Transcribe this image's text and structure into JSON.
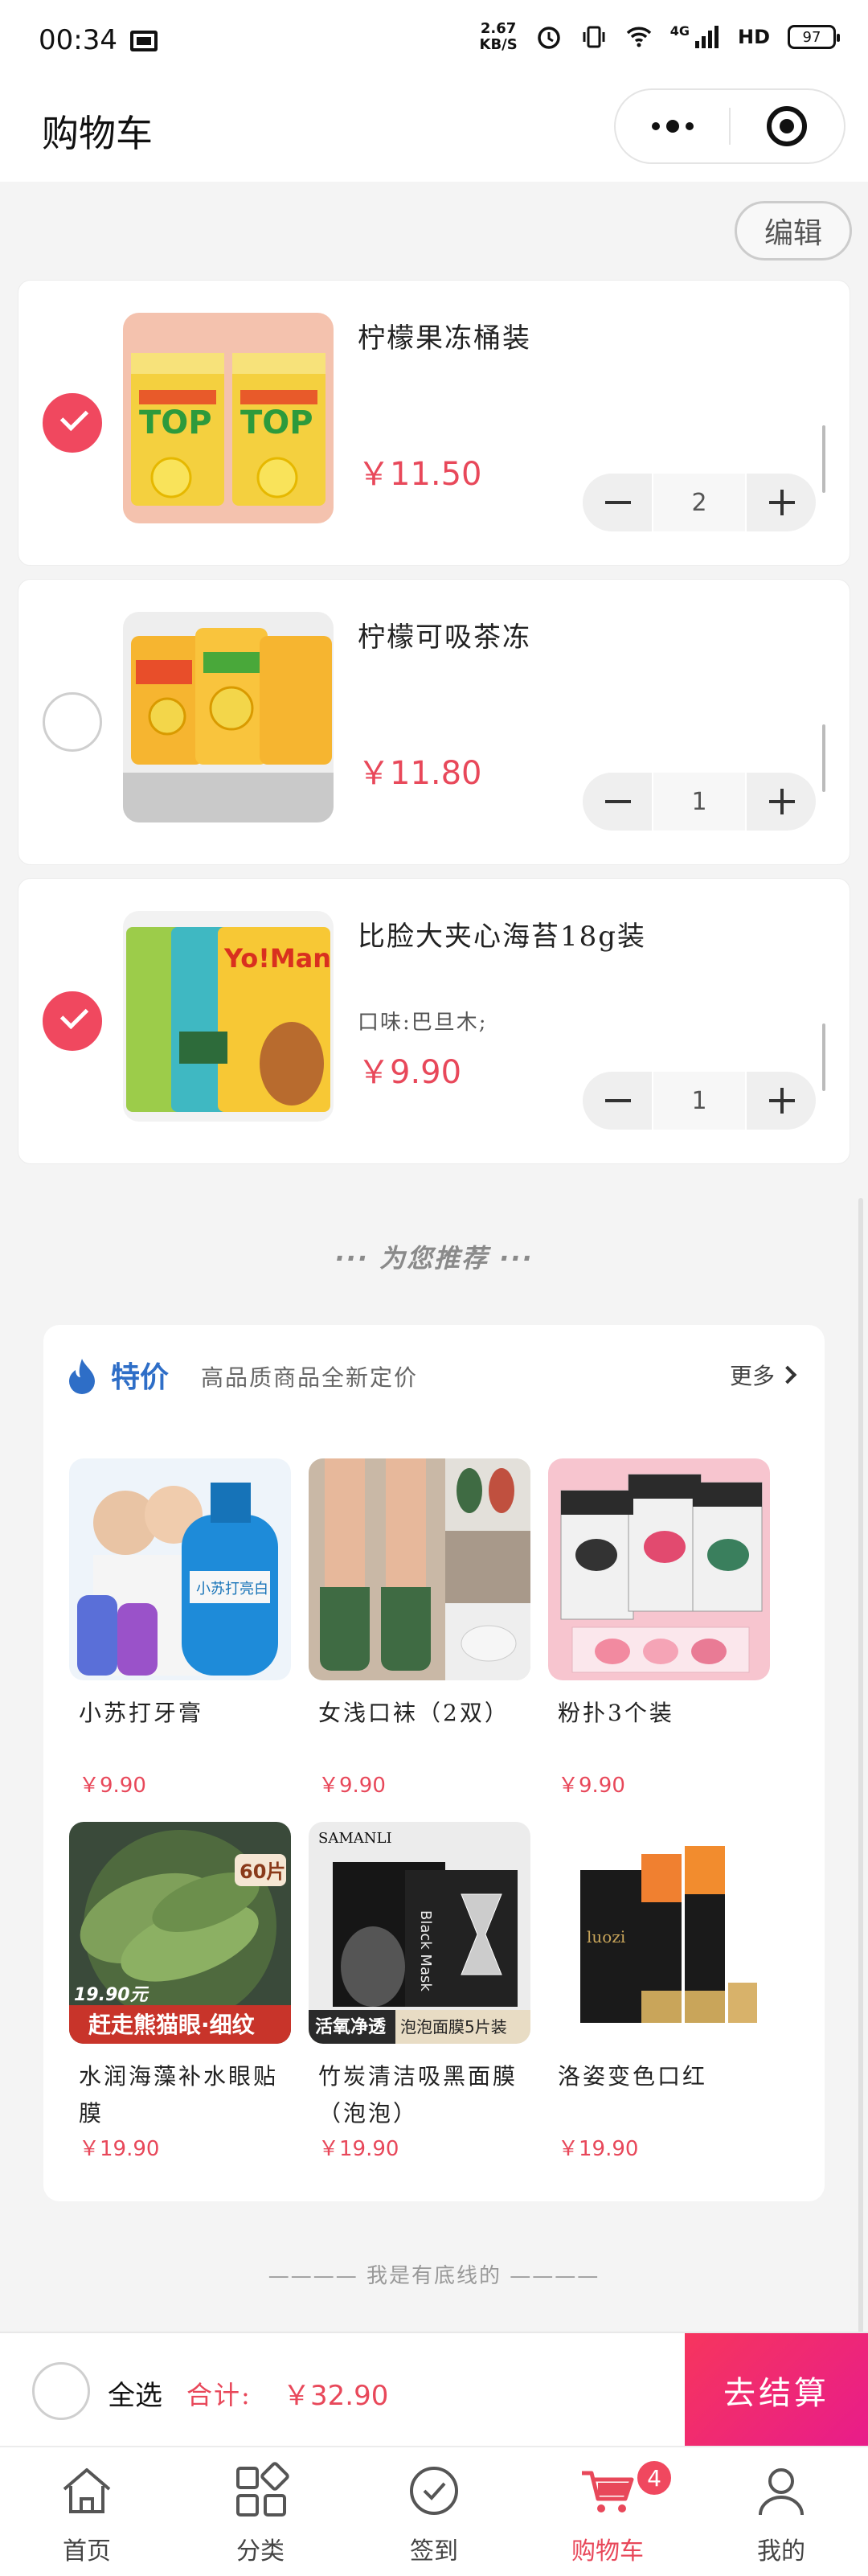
{
  "status_bar": {
    "time": "00:34",
    "speed_value": "2.67",
    "speed_unit": "KB/S",
    "network": "4G",
    "hd": "HD",
    "battery": "97"
  },
  "header": {
    "title": "购物车"
  },
  "edit_label": "编辑",
  "cart": {
    "items": [
      {
        "name": "柠檬果冻桶装",
        "spec": "",
        "price": "￥11.50",
        "quantity": "2",
        "checked": true
      },
      {
        "name": "柠檬可吸茶冻",
        "spec": "",
        "price": "￥11.80",
        "quantity": "1",
        "checked": false
      },
      {
        "name": "比脸大夹心海苔18g装",
        "spec": "口味:巴旦木;",
        "price": "￥9.90",
        "quantity": "1",
        "checked": true
      }
    ]
  },
  "recommend": {
    "heading": "··· 为您推荐 ···",
    "section_title": "特价",
    "section_subtitle": "高品质商品全新定价",
    "more_label": "更多",
    "products": [
      {
        "name": "小苏打牙膏",
        "price": "￥9.90"
      },
      {
        "name": "女浅口袜（2双）",
        "price": "￥9.90"
      },
      {
        "name": "粉扑3个装",
        "price": "￥9.90"
      },
      {
        "name": "水润海藻补水眼贴膜",
        "price": "￥19.90"
      },
      {
        "name": "竹炭清洁吸黑面膜（泡泡）",
        "price": "￥19.90"
      },
      {
        "name": "洛姿变色口红",
        "price": "￥19.90"
      }
    ],
    "image_text": {
      "toothpaste_brand": "小苏打亮白",
      "eye_count": "60片",
      "eye_price": "19.90元",
      "eye_banner": "赶走熊猫眼·细纹",
      "mask_brand": "SAMANLI",
      "mask_label": "Black Mask",
      "mask_banner_a": "活氧净透",
      "mask_banner_b": "泡泡面膜5片装",
      "lipstick_brand": "luozi",
      "jelly_label": "TOP",
      "snack_label": "Yo!Man"
    }
  },
  "bottom_line": "———— 我是有底线的 ————",
  "checkout": {
    "select_all_label": "全选",
    "total_label": "合计:",
    "total_value": "￥32.90",
    "checkout_label": "去结算"
  },
  "tabs": [
    {
      "label": "首页",
      "icon": "home-icon"
    },
    {
      "label": "分类",
      "icon": "category-icon"
    },
    {
      "label": "签到",
      "icon": "check-in-icon"
    },
    {
      "label": "购物车",
      "icon": "cart-icon",
      "badge": "4",
      "active": true
    },
    {
      "label": "我的",
      "icon": "user-icon"
    }
  ],
  "colors": {
    "accent": "#e8485a",
    "checked": "#f0485f",
    "checkout_gradient_start": "#f6355e",
    "checkout_gradient_end": "#e81c8a",
    "recommend_title": "#2e6ec7"
  }
}
